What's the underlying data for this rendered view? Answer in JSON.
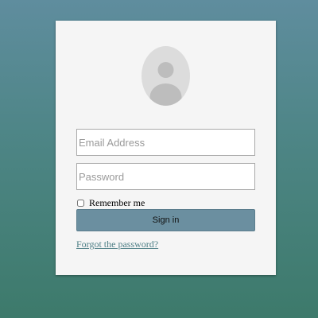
{
  "login": {
    "avatar_icon": "user-silhouette-icon",
    "email": {
      "value": "",
      "placeholder": "Email Address"
    },
    "password": {
      "value": "",
      "placeholder": "Password"
    },
    "remember": {
      "label": "Remember me",
      "checked": false
    },
    "signin_label": "Sign in",
    "forgot_label": "Forgot the password?"
  },
  "colors": {
    "background_top": "#5f8d9e",
    "background_bottom": "#3d7a6b",
    "card": "#f5f5f5",
    "button": "#6b8fa0",
    "link": "#4e7f86"
  }
}
